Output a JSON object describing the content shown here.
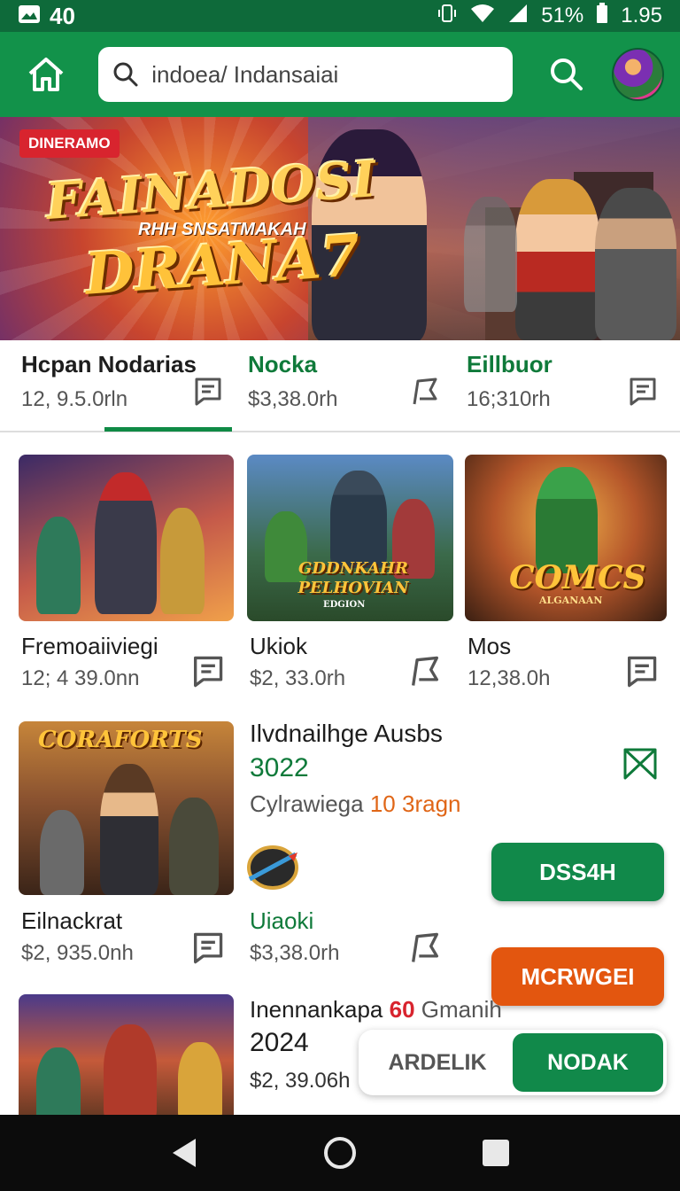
{
  "status": {
    "time_left": "40",
    "battery": "51%",
    "clock": "1.95"
  },
  "search": {
    "query": "indoea/ Indansaiai"
  },
  "hero": {
    "tag": "DINERAMO",
    "title_line1": "FAINADOSI",
    "subtitle": "RHH SNSATMAKAH",
    "title_line2": "DRANA7"
  },
  "tabs": [
    {
      "title": "Hcpan Nodarias",
      "sub": "12, 9.5.0rln"
    },
    {
      "title": "Nocka",
      "sub": "$3,38.0rh"
    },
    {
      "title": "Eillbuor",
      "sub": "16;310rh"
    }
  ],
  "row1": [
    {
      "title": "Fremoaiiviegi",
      "price": "12; 4 39.0nn",
      "thumb_label": ""
    },
    {
      "title": "Ukiok",
      "price": "$2, 33.0rh",
      "thumb_label": "GDDNKAHR PELHOVIAN",
      "thumb_sub": "EDGION"
    },
    {
      "title": "Mos",
      "price": "12,38.0h",
      "thumb_label": "COMCS",
      "thumb_sub": "ALGANAAN"
    }
  ],
  "feature": {
    "thumb_label": "CORAFORTS",
    "title": "Ilvdnailhge Ausbs",
    "year": "3022",
    "line_prefix": "Cylrawiega",
    "line_accent": "10 3ragn",
    "card_title": "Eilnackrat",
    "card_price": "$2, 935.0nh",
    "sub_title": "Uiaoki",
    "sub_price": "$3,38.0rh",
    "btn_primary": "DSS4H",
    "btn_secondary": "MCRWGEI"
  },
  "bottom": {
    "title_prefix": "Inennankapa",
    "title_accent": "60",
    "title_suffix": "Gmanih",
    "year": "2024",
    "price": "$2, 39.06h"
  },
  "segmented": {
    "left": "ARDELIK",
    "right": "NODAK"
  },
  "colors": {
    "brand": "#12924a",
    "accent_orange": "#e3560f"
  }
}
